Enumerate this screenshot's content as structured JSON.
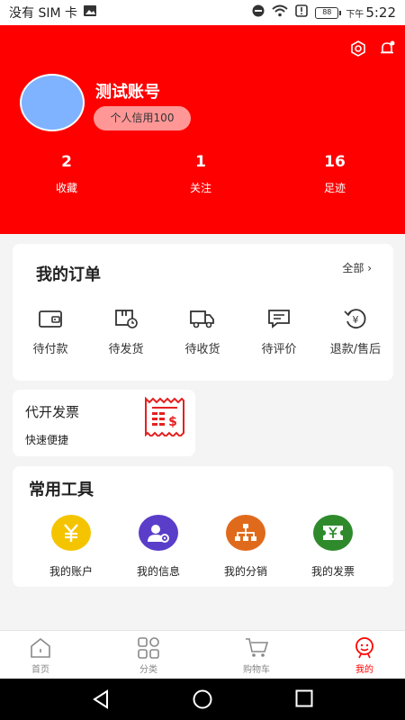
{
  "status_bar": {
    "carrier": "没有 SIM 卡",
    "ampm": "下午",
    "time": "5:22",
    "battery": "88"
  },
  "profile": {
    "username": "测试账号",
    "credit_label": "个人信用100",
    "stats": [
      {
        "value": "2",
        "label": "收藏"
      },
      {
        "value": "1",
        "label": "关注"
      },
      {
        "value": "16",
        "label": "足迹"
      }
    ]
  },
  "orders": {
    "title": "我的订单",
    "all_label": "全部",
    "items": [
      {
        "label": "待付款",
        "icon": "wallet-icon"
      },
      {
        "label": "待发货",
        "icon": "package-clock-icon"
      },
      {
        "label": "待收货",
        "icon": "truck-icon"
      },
      {
        "label": "待评价",
        "icon": "comment-icon"
      },
      {
        "label": "退款/售后",
        "icon": "refund-yen-icon"
      }
    ]
  },
  "invoice_card": {
    "title": "代开发票",
    "subtitle": "快速便捷"
  },
  "tools": {
    "title": "常用工具",
    "items": [
      {
        "label": "我的账户",
        "icon": "yen-icon",
        "color": "#f5c400"
      },
      {
        "label": "我的信息",
        "icon": "user-gear-icon",
        "color": "#5a3dc8"
      },
      {
        "label": "我的分销",
        "icon": "network-icon",
        "color": "#e06a1b"
      },
      {
        "label": "我的发票",
        "icon": "ticket-yen-icon",
        "color": "#2f8a2c"
      }
    ]
  },
  "tabbar": {
    "items": [
      {
        "label": "首页",
        "icon": "home-icon"
      },
      {
        "label": "分类",
        "icon": "grid-icon"
      },
      {
        "label": "购物车",
        "icon": "cart-icon"
      },
      {
        "label": "我的",
        "icon": "user-face-icon",
        "active": true
      }
    ]
  },
  "colors": {
    "brand": "#ff0000",
    "avatar": "#7fb2ff",
    "credit_pill": "#ff9797"
  }
}
